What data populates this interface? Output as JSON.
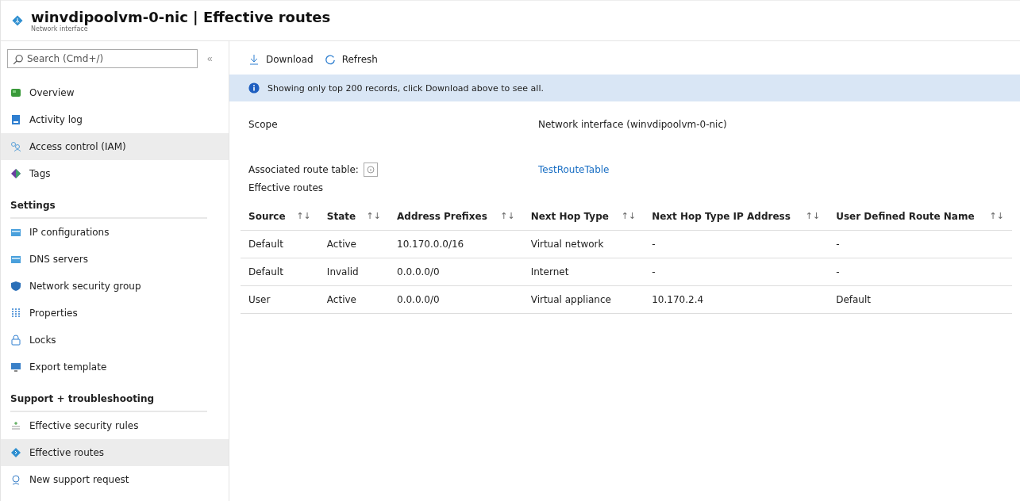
{
  "header": {
    "title": "winvdipoolvm-0-nic | Effective routes",
    "subtitle": "Network interface"
  },
  "sidebar": {
    "search": {
      "placeholder": "Search (Cmd+/)"
    },
    "collapse": "«",
    "groups": [
      {
        "items": [
          {
            "label": "Overview",
            "highlighted": false
          },
          {
            "label": "Activity log",
            "highlighted": false
          },
          {
            "label": "Access control (IAM)",
            "highlighted": true
          },
          {
            "label": "Tags",
            "highlighted": false
          }
        ]
      },
      {
        "heading": "Settings",
        "items": [
          {
            "label": "IP configurations",
            "highlighted": false
          },
          {
            "label": "DNS servers",
            "highlighted": false
          },
          {
            "label": "Network security group",
            "highlighted": false
          },
          {
            "label": "Properties",
            "highlighted": false
          },
          {
            "label": "Locks",
            "highlighted": false
          },
          {
            "label": "Export template",
            "highlighted": false
          }
        ]
      },
      {
        "heading": "Support + troubleshooting",
        "items": [
          {
            "label": "Effective security rules",
            "highlighted": false
          },
          {
            "label": "Effective routes",
            "highlighted": true
          },
          {
            "label": "New support request",
            "highlighted": false
          }
        ]
      }
    ]
  },
  "toolbar": [
    {
      "kind": "download",
      "label": "Download"
    },
    {
      "kind": "refresh",
      "label": "Refresh"
    }
  ],
  "banner": "Showing only top 200 records, click Download above to see all.",
  "details": [
    {
      "kind": "text",
      "label": "Scope",
      "value": "Network interface (winvdipoolvm-0-nic)"
    },
    {
      "kind": "link",
      "label": "Associated route table:",
      "value": "TestRouteTable"
    }
  ],
  "section_title": "Effective routes",
  "table": {
    "columns": [
      {
        "label": "Source",
        "sort": "↑↓"
      },
      {
        "label": "State",
        "sort": "↑↓"
      },
      {
        "label": "Address Prefixes",
        "sort": "↑↓"
      },
      {
        "label": "Next Hop Type",
        "sort": "↑↓"
      },
      {
        "label": "Next Hop Type IP Address",
        "sort": "↑↓"
      },
      {
        "label": "User Defined Route Name",
        "sort": "↑↓"
      }
    ],
    "rows": [
      [
        "Default",
        "Active",
        "10.170.0.0/16",
        "Virtual network",
        "-",
        "-"
      ],
      [
        "Default",
        "Invalid",
        "0.0.0.0/0",
        "Internet",
        "-",
        "-"
      ],
      [
        "User",
        "Active",
        "0.0.0.0/0",
        "Virtual appliance",
        "10.170.2.4",
        "Default"
      ]
    ]
  }
}
